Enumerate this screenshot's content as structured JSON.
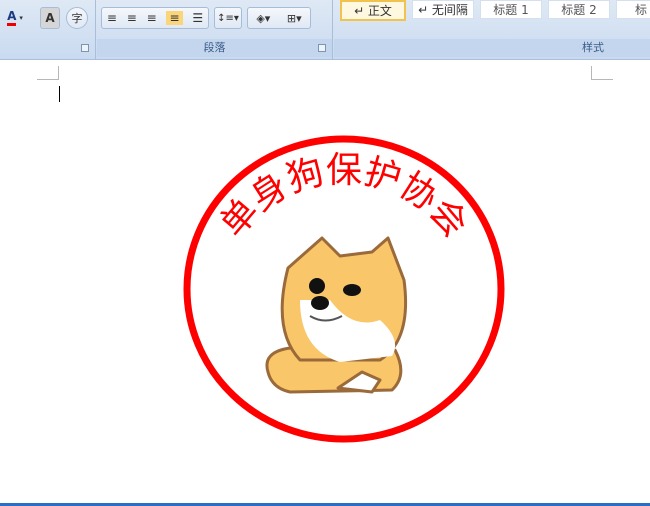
{
  "ribbon": {
    "font_group": {
      "font_color_icon": "font-color-icon",
      "char_shading_label": "A",
      "enclosed_char_label": "字"
    },
    "paragraph_group": {
      "label": "段落",
      "buttons": [
        "align-left",
        "align-center",
        "align-right",
        "justify",
        "distributed",
        "line-spacing",
        "shading",
        "borders"
      ],
      "active": "justify"
    },
    "styles_group": {
      "label": "样式",
      "styles": [
        "↵ 正文",
        "↵ 无间隔",
        "标题 1",
        "标题 2",
        "标"
      ],
      "selected": "↵ 正文"
    }
  },
  "document": {
    "seal_text": "单身狗保护协会",
    "seal_color": "#ff0000",
    "image": "doge-cartoon-dog"
  },
  "colors": {
    "ribbon": "#dfe9f5",
    "accent": "#2b6cc4"
  }
}
